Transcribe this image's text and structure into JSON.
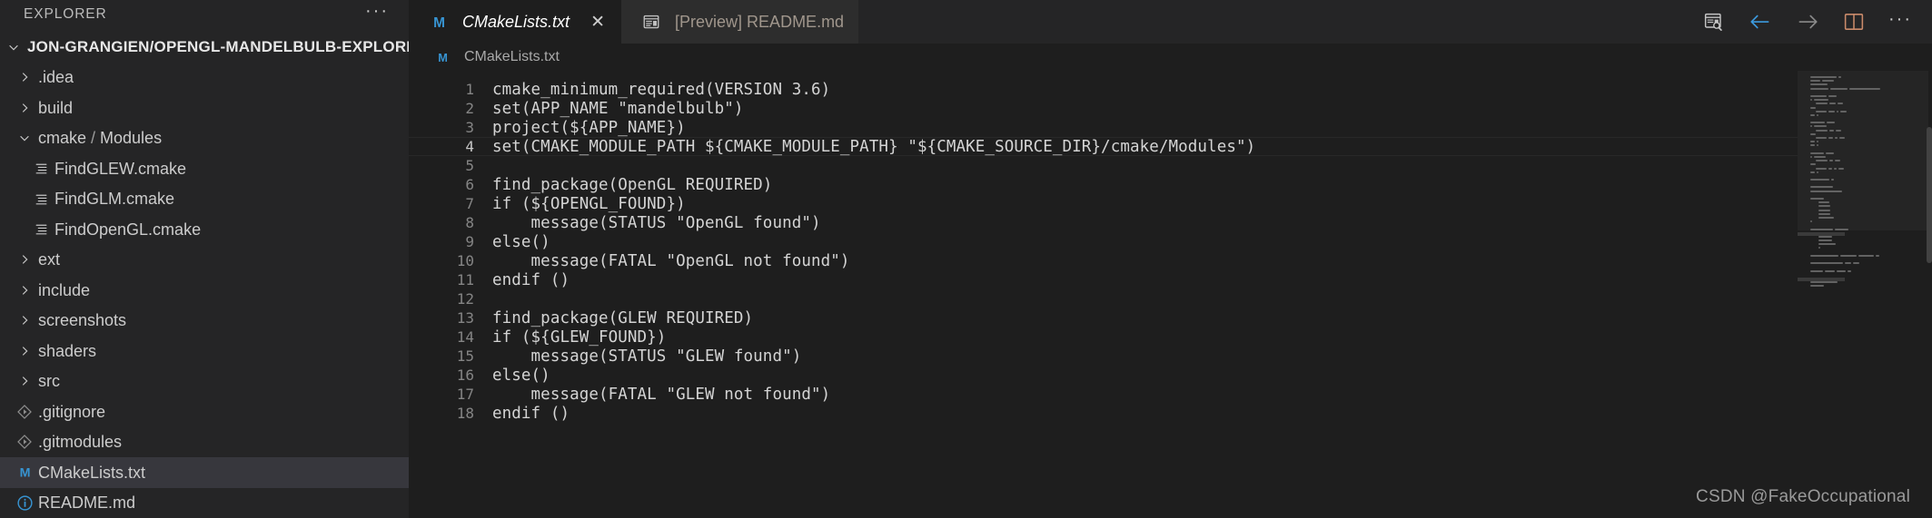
{
  "sidebar": {
    "header": {
      "title": "EXPLORER",
      "more_label": "···"
    },
    "root": {
      "label": "JON-GRANGIEN/OPENGL-MANDELBULB-EXPLORER",
      "expanded": true
    },
    "items": [
      {
        "label": ".idea",
        "type": "folder",
        "expanded": false,
        "indent": 1,
        "icon": "chevron-right-icon"
      },
      {
        "label": "build",
        "type": "folder",
        "expanded": false,
        "indent": 1,
        "icon": "chevron-right-icon"
      },
      {
        "label": "cmake",
        "label_suffix": "Modules",
        "type": "folder",
        "expanded": true,
        "indent": 1,
        "icon": "chevron-down-icon"
      },
      {
        "label": "FindGLEW.cmake",
        "type": "file",
        "indent": 2,
        "icon": "cmake-file-icon"
      },
      {
        "label": "FindGLM.cmake",
        "type": "file",
        "indent": 2,
        "icon": "cmake-file-icon"
      },
      {
        "label": "FindOpenGL.cmake",
        "type": "file",
        "indent": 2,
        "icon": "cmake-file-icon"
      },
      {
        "label": "ext",
        "type": "folder",
        "expanded": false,
        "indent": 1,
        "icon": "chevron-right-icon"
      },
      {
        "label": "include",
        "type": "folder",
        "expanded": false,
        "indent": 1,
        "icon": "chevron-right-icon"
      },
      {
        "label": "screenshots",
        "type": "folder",
        "expanded": false,
        "indent": 1,
        "icon": "chevron-right-icon"
      },
      {
        "label": "shaders",
        "type": "folder",
        "expanded": false,
        "indent": 1,
        "icon": "chevron-right-icon"
      },
      {
        "label": "src",
        "type": "folder",
        "expanded": false,
        "indent": 1,
        "icon": "chevron-right-icon"
      },
      {
        "label": ".gitignore",
        "type": "file",
        "indent": 1,
        "icon": "git-file-icon"
      },
      {
        "label": ".gitmodules",
        "type": "file",
        "indent": 1,
        "icon": "git-file-icon"
      },
      {
        "label": "CMakeLists.txt",
        "type": "file",
        "indent": 1,
        "icon": "markdown-m-icon",
        "selected": true
      },
      {
        "label": "README.md",
        "type": "file",
        "indent": 1,
        "icon": "info-circle-icon"
      }
    ]
  },
  "tabs": [
    {
      "label": "CMakeLists.txt",
      "icon": "markdown-m-icon",
      "active": true,
      "italic": true,
      "close_label": "✕"
    },
    {
      "label": "[Preview] README.md",
      "icon": "preview-icon",
      "active": false,
      "italic": false
    }
  ],
  "tab_actions": [
    {
      "name": "open-preview-icon",
      "title": "Open Preview"
    },
    {
      "name": "back-arrow-icon",
      "title": "Go Back"
    },
    {
      "name": "forward-arrow-icon",
      "title": "Go Forward"
    },
    {
      "name": "split-editor-icon",
      "title": "Split Editor"
    },
    {
      "name": "more-actions-icon",
      "title": "More Actions...",
      "label": "···"
    }
  ],
  "breadcrumb": {
    "icon": "markdown-m-icon",
    "label": "CMakeLists.txt"
  },
  "editor": {
    "language": "cmake",
    "current_line": 4,
    "lines": [
      {
        "n": "1",
        "text": "cmake_minimum_required(VERSION 3.6)"
      },
      {
        "n": "2",
        "text": "set(APP_NAME \"mandelbulb\")"
      },
      {
        "n": "3",
        "text": "project(${APP_NAME})"
      },
      {
        "n": "4",
        "text": "set(CMAKE_MODULE_PATH ${CMAKE_MODULE_PATH} \"${CMAKE_SOURCE_DIR}/cmake/Modules\")"
      },
      {
        "n": "5",
        "text": ""
      },
      {
        "n": "6",
        "text": "find_package(OpenGL REQUIRED)"
      },
      {
        "n": "7",
        "text": "if (${OPENGL_FOUND})"
      },
      {
        "n": "8",
        "text": "    message(STATUS \"OpenGL found\")"
      },
      {
        "n": "9",
        "text": "else()"
      },
      {
        "n": "10",
        "text": "    message(FATAL \"OpenGL not found\")"
      },
      {
        "n": "11",
        "text": "endif ()"
      },
      {
        "n": "12",
        "text": ""
      },
      {
        "n": "13",
        "text": "find_package(GLEW REQUIRED)"
      },
      {
        "n": "14",
        "text": "if (${GLEW_FOUND})"
      },
      {
        "n": "15",
        "text": "    message(STATUS \"GLEW found\")"
      },
      {
        "n": "16",
        "text": "else()"
      },
      {
        "n": "17",
        "text": "    message(FATAL \"GLEW not found\")"
      },
      {
        "n": "18",
        "text": "endif ()"
      }
    ]
  },
  "watermark": {
    "text": "CSDN @FakeOccupational"
  },
  "colors": {
    "editor_bg": "#1e1e1e",
    "sidebar_bg": "#252526",
    "tab_inactive_bg": "#2d2d2d",
    "selection_bg": "#37373d",
    "text": "#cccccc",
    "code_text": "#d4d4d4",
    "line_number": "#858585",
    "accent_blue": "#3794d2",
    "accent_orange": "#d19a66"
  }
}
